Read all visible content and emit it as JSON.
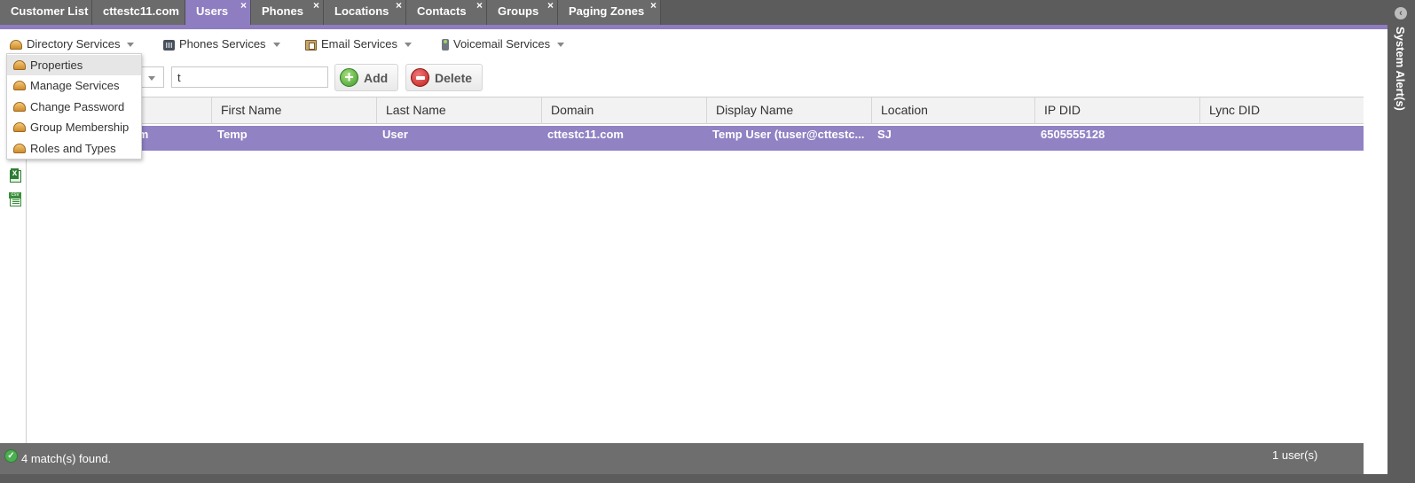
{
  "tabs": [
    {
      "label": "Customer List",
      "closable": false,
      "active": false
    },
    {
      "label": "cttestc11.com",
      "closable": false,
      "active": false
    },
    {
      "label": "Users",
      "closable": true,
      "active": true
    },
    {
      "label": "Phones",
      "closable": true,
      "active": false
    },
    {
      "label": "Locations",
      "closable": true,
      "active": false
    },
    {
      "label": "Contacts",
      "closable": true,
      "active": false
    },
    {
      "label": "Groups",
      "closable": true,
      "active": false
    },
    {
      "label": "Paging Zones",
      "closable": true,
      "active": false
    }
  ],
  "tab_close_glyph": "×",
  "alerts": {
    "label": "System Alert(s)",
    "toggle_glyph": "‹"
  },
  "services": [
    {
      "label": "Directory Services",
      "icon": "user-dome-icon"
    },
    {
      "label": "Phones Services",
      "icon": "phone-icon"
    },
    {
      "label": "Email Services",
      "icon": "email-icon"
    },
    {
      "label": "Voicemail Services",
      "icon": "voicemail-icon"
    }
  ],
  "dropdown": {
    "items": [
      {
        "label": "Properties"
      },
      {
        "label": "Manage Services"
      },
      {
        "label": "Change Password"
      },
      {
        "label": "Group Membership"
      },
      {
        "label": "Roles and Types"
      }
    ]
  },
  "toolbar": {
    "search_value": "t",
    "add_label": "Add",
    "delete_label": "Delete"
  },
  "grid": {
    "columns": [
      "First Name",
      "Last Name",
      "Domain",
      "Display Name",
      "Location",
      "IP DID",
      "Lync DID"
    ],
    "row": {
      "user_id_fragment": ".com",
      "first_name": "Temp",
      "last_name": "User",
      "domain": "cttestc11.com",
      "display_name": "Temp User (tuser@cttestc...",
      "location": "SJ",
      "ip_did": "6505555128",
      "lync_did": ""
    }
  },
  "status": {
    "left": "4 match(s) found.",
    "right": "1 user(s)"
  },
  "colors": {
    "accent": "#8e7dc0",
    "selected_row": "#9182c4",
    "chrome": "#5c5c5c"
  }
}
